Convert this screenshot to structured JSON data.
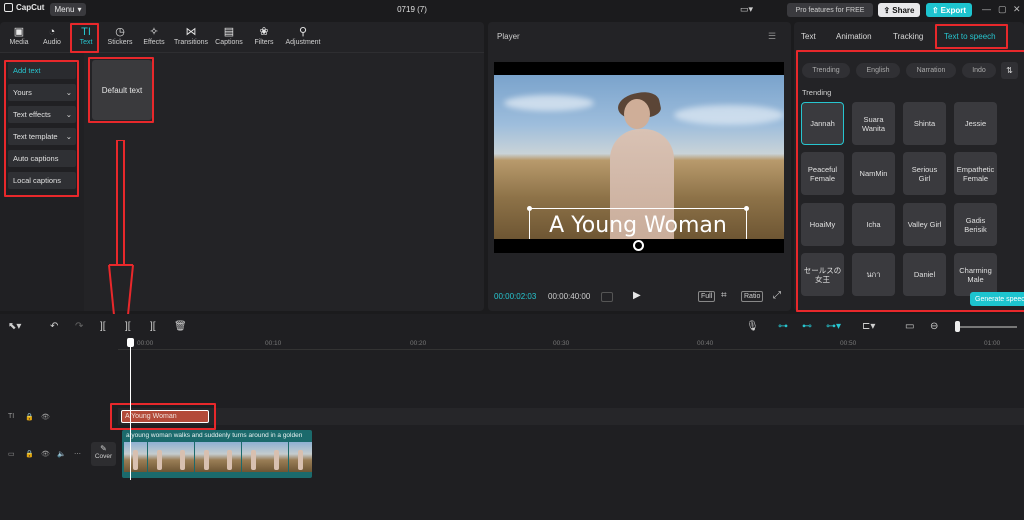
{
  "app": {
    "logo": "CapCut",
    "menu_label": "Menu",
    "project_title": "0719 (7)",
    "pro_label": "Pro features for FREE",
    "share_label": "Share",
    "export_label": "Export"
  },
  "toolbar": {
    "items": [
      {
        "label": "Media",
        "icon": "media-icon"
      },
      {
        "label": "Audio",
        "icon": "audio-icon"
      },
      {
        "label": "Text",
        "icon": "text-icon"
      },
      {
        "label": "Stickers",
        "icon": "stickers-icon"
      },
      {
        "label": "Effects",
        "icon": "effects-icon"
      },
      {
        "label": "Transitions",
        "icon": "transitions-icon"
      },
      {
        "label": "Captions",
        "icon": "captions-icon"
      },
      {
        "label": "Filters",
        "icon": "filters-icon"
      },
      {
        "label": "Adjustment",
        "icon": "adjustment-icon"
      }
    ],
    "active": "Text"
  },
  "sidebar": {
    "items": [
      {
        "label": "Add text"
      },
      {
        "label": "Yours"
      },
      {
        "label": "Text effects"
      },
      {
        "label": "Text template"
      },
      {
        "label": "Auto captions"
      },
      {
        "label": "Local captions"
      }
    ]
  },
  "text_library": {
    "default_card_label": "Default text"
  },
  "player": {
    "title": "Player",
    "overlay_text": "A Young Woman",
    "time_current": "00:00:02:03",
    "time_total": "00:00:40:00",
    "full_label": "Full",
    "ratio_label": "Ratio"
  },
  "right_panel": {
    "tabs": [
      "Text",
      "Animation",
      "Tracking",
      "Text to speech"
    ],
    "active_tab": "Text to speech",
    "chips": [
      "Trending",
      "English",
      "Narration",
      "Indo"
    ],
    "section_label": "Trending",
    "voices": [
      "Jannah",
      "Suara Wanita",
      "Shinta",
      "Jessie",
      "Peaceful Female",
      "NamMin",
      "Serious Girl",
      "Empathetic Female",
      "HoaiMy",
      "Icha",
      "Valley Girl",
      "Gadis Berisik",
      "セールスの女王",
      "นกา",
      "Daniel",
      "Charming Male"
    ],
    "selected_voice": "Jannah",
    "generate_label": "Generate speech"
  },
  "timeline": {
    "ticks": [
      "00:00",
      "00:10",
      "00:20",
      "00:30",
      "00:40",
      "00:50",
      "01:00"
    ],
    "text_clip_label": "A Young Woman",
    "video_clip_label": "a young woman walks and suddenly turns around in a golden",
    "cover_label": "Cover"
  },
  "colors": {
    "accent": "#27c5cf",
    "annotation": "#e8282b"
  }
}
